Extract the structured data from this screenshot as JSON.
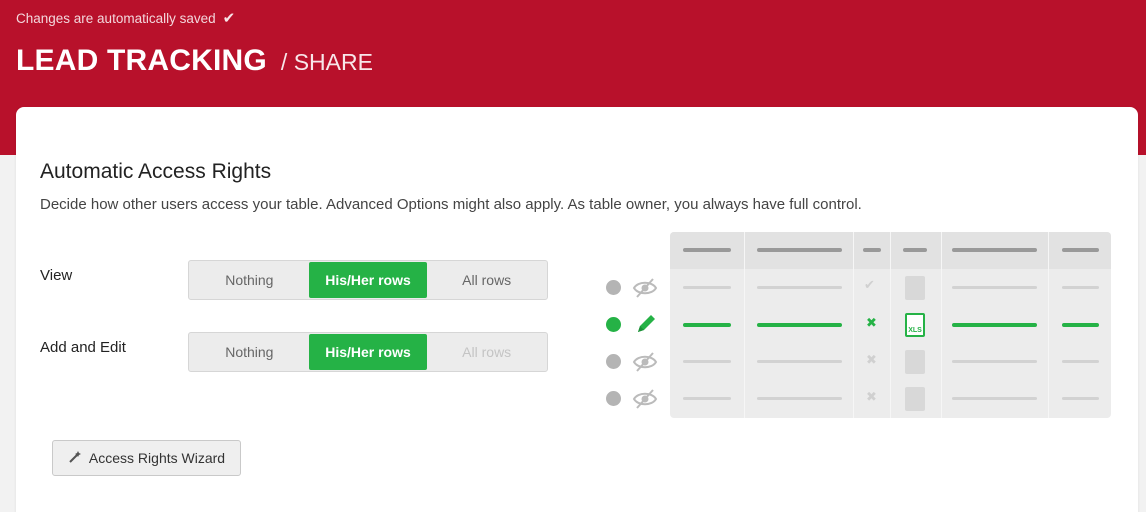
{
  "header": {
    "saved_text": "Changes are automatically saved",
    "title": "LEAD TRACKING",
    "subtitle": "/ SHARE",
    "color": "#b8112b"
  },
  "section": {
    "heading": "Automatic Access Rights",
    "description": "Decide how other users access your table. Advanced Options might also apply. As table owner, you always have full control."
  },
  "view": {
    "label": "View",
    "options": [
      "Nothing",
      "His/Her rows",
      "All rows"
    ],
    "selected": "His/Her rows"
  },
  "add_edit": {
    "label": "Add and Edit",
    "options": [
      "Nothing",
      "His/Her rows",
      "All rows"
    ],
    "selected": "His/Her rows",
    "disabled_option": "All rows"
  },
  "wizard": {
    "label": "Access Rights Wizard",
    "icon": "magic-wand-icon"
  },
  "preview": {
    "rows": [
      {
        "status": "inactive",
        "icon": "eye-slash-icon"
      },
      {
        "status": "active",
        "icon": "pencil-icon"
      },
      {
        "status": "inactive",
        "icon": "eye-slash-icon"
      },
      {
        "status": "inactive",
        "icon": "eye-slash-icon"
      }
    ],
    "accent": "#25b246"
  }
}
